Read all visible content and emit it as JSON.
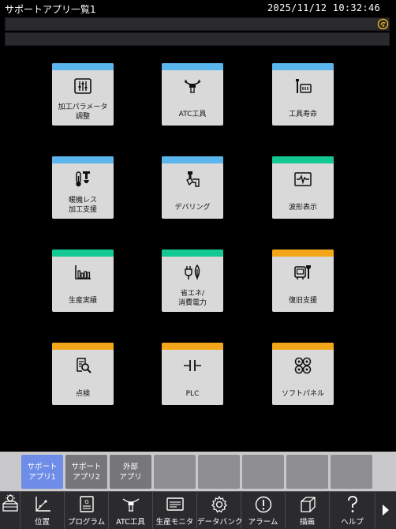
{
  "window": {
    "title": "サポートアプリ一覧1",
    "datetime": "2025/11/12 10:32:46"
  },
  "colors": {
    "blue_stripe": "#5ab6ec",
    "green_stripe": "#14c894",
    "orange_stripe": "#f4a61a",
    "active_tab": "#6e8de8"
  },
  "tiles": [
    {
      "label": "加工パラメータ\n調整",
      "icon": "sliders-icon",
      "stripe": "#5ab6ec"
    },
    {
      "label": "ATC工具",
      "icon": "atc-tool-icon",
      "stripe": "#5ab6ec"
    },
    {
      "label": "工具寿命",
      "icon": "tool-life-icon",
      "stripe": "#5ab6ec"
    },
    {
      "label": "暖機レス\n加工支援",
      "icon": "thermometer-icon",
      "stripe": "#5ab6ec"
    },
    {
      "label": "デバリング",
      "icon": "deburring-icon",
      "stripe": "#5ab6ec"
    },
    {
      "label": "波形表示",
      "icon": "waveform-icon",
      "stripe": "#14c894"
    },
    {
      "label": "生産実績",
      "icon": "bar-chart-icon",
      "stripe": "#14c894"
    },
    {
      "label": "省エネ/\n消費電力",
      "icon": "energy-icon",
      "stripe": "#14c894"
    },
    {
      "label": "復旧支援",
      "icon": "recovery-icon",
      "stripe": "#f4a61a"
    },
    {
      "label": "点検",
      "icon": "inspection-icon",
      "stripe": "#f4a61a"
    },
    {
      "label": "PLC",
      "icon": "plc-icon",
      "stripe": "#f4a61a"
    },
    {
      "label": "ソフトパネル",
      "icon": "soft-panel-icon",
      "stripe": "#f4a61a"
    }
  ],
  "tabs": [
    {
      "label": "サポート\nアプリ1",
      "state": "active"
    },
    {
      "label": "サポート\nアプリ2",
      "state": "normal"
    },
    {
      "label": "外部\nアプリ",
      "state": "normal"
    }
  ],
  "function_keys": [
    {
      "label": "位置",
      "icon": "position-icon"
    },
    {
      "label": "プログラム",
      "icon": "program-icon"
    },
    {
      "label": "ATC工具",
      "icon": "atc-tool-icon"
    },
    {
      "label": "生産モニタ",
      "icon": "monitor-icon"
    },
    {
      "label": "データバンク",
      "icon": "gear-icon"
    },
    {
      "label": "アラーム",
      "icon": "alarm-icon"
    },
    {
      "label": "描画",
      "icon": "cube-icon"
    },
    {
      "label": "ヘルプ",
      "icon": "help-icon"
    }
  ]
}
